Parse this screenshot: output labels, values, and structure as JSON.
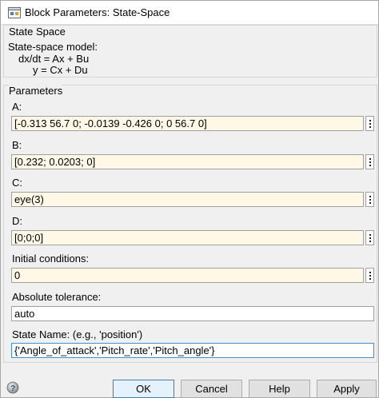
{
  "window": {
    "title": "Block Parameters: State-Space"
  },
  "description": {
    "group_title": "State Space",
    "lines": [
      "State-space model:",
      "dx/dt = Ax + Bu",
      "y = Cx + Du"
    ]
  },
  "parameters": {
    "group_title": "Parameters",
    "A": {
      "label": "A:",
      "value": "[-0.313 56.7 0; -0.0139 -0.426 0; 0 56.7 0]"
    },
    "B": {
      "label": "B:",
      "value": "[0.232; 0.0203; 0]"
    },
    "C": {
      "label": "C:",
      "value": "eye(3)"
    },
    "D": {
      "label": "D:",
      "value": "[0;0;0]"
    },
    "initial": {
      "label": "Initial conditions:",
      "value": "0"
    },
    "tolerance": {
      "label": "Absolute tolerance:",
      "value": "auto"
    },
    "state_name": {
      "label": "State Name: (e.g., 'position')",
      "value": "{'Angle_of_attack','Pitch_rate','Pitch_angle'}"
    }
  },
  "buttons": {
    "ok": "OK",
    "cancel": "Cancel",
    "help": "Help",
    "apply": "Apply"
  },
  "icons": {
    "title": "simulink-block-icon",
    "help": "help-question-icon",
    "more": "vertical-dots-icon"
  },
  "colors": {
    "editable_field_bg": "#fff8e6",
    "focus_border": "#3f8fd8",
    "default_button_border": "#3c7fb1"
  }
}
